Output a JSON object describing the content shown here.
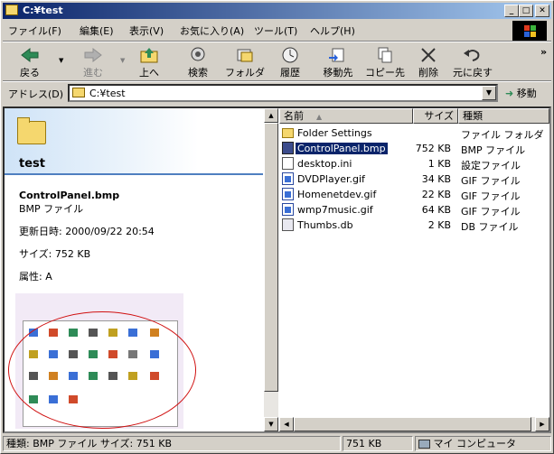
{
  "window": {
    "title": "C:¥test",
    "min": "_",
    "max": "□",
    "close": "✕"
  },
  "menu": [
    "ファイル(F)",
    "編集(E)",
    "表示(V)",
    "お気に入り(A)",
    "ツール(T)",
    "ヘルプ(H)"
  ],
  "toolbar": {
    "back": "戻る",
    "forward": "進む",
    "up": "上へ",
    "search": "検索",
    "folders": "フォルダ",
    "history": "履歴",
    "moveto": "移動先",
    "copyto": "コピー先",
    "delete": "削除",
    "undo": "元に戻す",
    "chevron": "»"
  },
  "address": {
    "label": "アドレス(D)",
    "value": "C:¥test",
    "go": "移動"
  },
  "leftpane": {
    "folder_title": "test",
    "file_name": "ControlPanel.bmp",
    "file_type": "BMP ファイル",
    "modified": "更新日時: 2000/09/22 20:54",
    "size": "サイズ: 752 KB",
    "attributes": "属性: A"
  },
  "list": {
    "headers": {
      "name": "名前",
      "size": "サイズ",
      "type": "種類",
      "sort": "▲"
    },
    "items": [
      {
        "name": "Folder Settings",
        "size": "",
        "type": "ファイル フォルダ",
        "icon": "folder-icon"
      },
      {
        "name": "ControlPanel.bmp",
        "size": "752 KB",
        "type": "BMP ファイル",
        "icon": "bmp-icon",
        "selected": true
      },
      {
        "name": "desktop.ini",
        "size": "1 KB",
        "type": "設定ファイル",
        "icon": "ini-icon"
      },
      {
        "name": "DVDPlayer.gif",
        "size": "34 KB",
        "type": "GIF ファイル",
        "icon": "gif-icon"
      },
      {
        "name": "Homenetdev.gif",
        "size": "22 KB",
        "type": "GIF ファイル",
        "icon": "gif-icon"
      },
      {
        "name": "wmp7music.gif",
        "size": "64 KB",
        "type": "GIF ファイル",
        "icon": "gif-icon"
      },
      {
        "name": "Thumbs.db",
        "size": "2 KB",
        "type": "DB ファイル",
        "icon": "db-icon"
      }
    ]
  },
  "status": {
    "main": "種類: BMP ファイル サイズ: 751 KB",
    "size": "751 KB",
    "zone": "マイ コンピュータ"
  }
}
